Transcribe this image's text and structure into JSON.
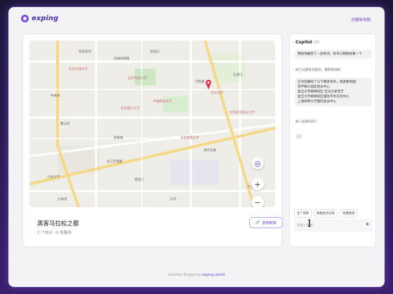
{
  "app": {
    "logo_text": "exping",
    "top_link": "创建新地图"
  },
  "card": {
    "title": "黑客马拉松之都",
    "subtitle": "1 个地点 · 0 条路线",
    "copy_button": "复制链接"
  },
  "map": {
    "labels": [
      "双安商场",
      "双榆树南路",
      "四道口",
      "北京科技大学",
      "中国政法大学",
      "京华大学",
      "北京理工大学",
      "北京交通大学",
      "北京邮电大学",
      "北京航空航天大学",
      "人民大学",
      "学院路",
      "知春路",
      "五道口",
      "清华东路",
      "中关村",
      "北三环西路",
      "西直门",
      "魏公村",
      "大钟寺",
      "三环",
      "北京大学"
    ],
    "pin_color": "#e02c4b",
    "controls": {
      "locate": "◎",
      "zoom_in": "+",
      "zoom_out": "−"
    }
  },
  "copilot": {
    "title": "Copilot",
    "count": "2/5",
    "messages": [
      "我给你推荐了一些地点。你可以稍微具看一下",
      "除了北邮及北航外，重新其他的",
      "已为您删除了以下相关地点，请查看地图:\n宝平联大酒店会议中心\n复旦大学邯郸校区-吉天凡新音厅\n复旦大学邯郸校区国际学术交流中心\n上海财政大学国际会议中心",
      "加一些新的吗?"
    ],
    "small_chip": "...",
    "actions": [
      "生个简称",
      "随意地点名称",
      "创建路线"
    ],
    "input_placeholder": "请输入你想...",
    "send_icon": "✦"
  },
  "footer": {
    "prefix": "Another Project by",
    "brand": "exping.world"
  }
}
